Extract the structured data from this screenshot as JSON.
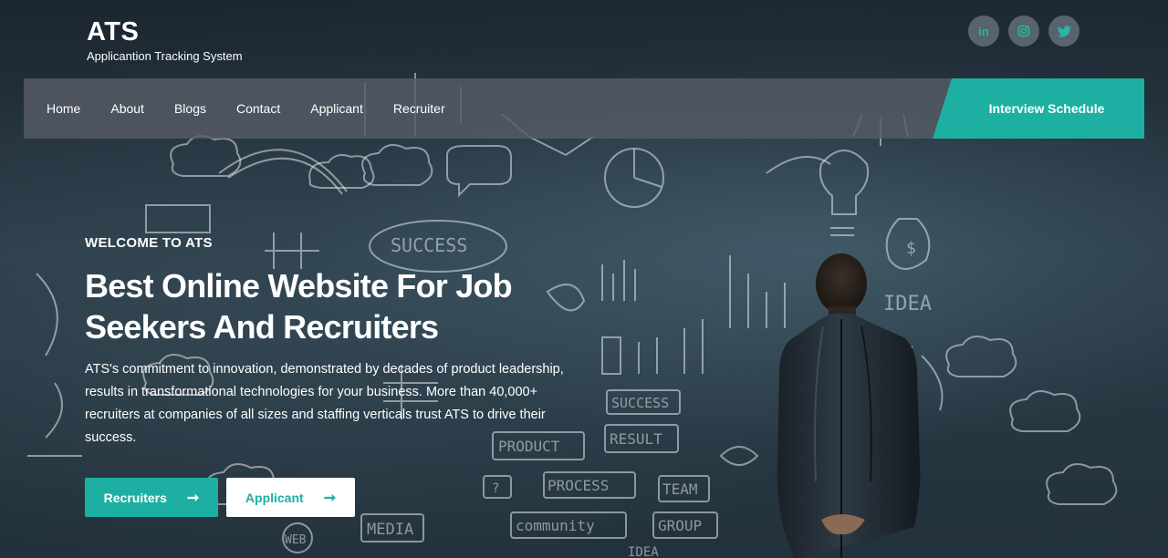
{
  "brand": {
    "title": "ATS",
    "subtitle": "Applicantion Tracking System"
  },
  "social": [
    {
      "label": "in",
      "icon": "linkedin-icon"
    },
    {
      "label": "◎",
      "icon": "instagram-icon"
    },
    {
      "label": "🐦",
      "icon": "twitter-icon"
    }
  ],
  "nav": {
    "items": [
      "Home",
      "About",
      "Blogs",
      "Contact",
      "Applicant",
      "Recruiter"
    ],
    "cta": "Interview Schedule"
  },
  "hero": {
    "eyebrow": "WELCOME TO ATS",
    "headline": "Best Online Website For Job Seekers And Recruiters",
    "description": "ATS's commitment to innovation, demonstrated by decades of product leadership, results in transformational technologies for your business. More than 40,000+ recruiters at companies of all sizes and staffing verticals trust ATS to drive their success.",
    "buttons": {
      "recruiters": "Recruiters",
      "applicant": "Applicant",
      "arrow": "➞"
    }
  },
  "sketch_words": [
    "SUCCESS",
    "SUCCESS",
    "RESULT",
    "PRODUCT",
    "PROCESS",
    "TEAM",
    "GROUP",
    "community",
    "MEDIA",
    "IDEA",
    "IDEA",
    "WEB",
    "?",
    "$"
  ],
  "colors": {
    "accent": "#1db0a2",
    "nav_bg": "#555c66",
    "bg_dark": "#1f2a33"
  }
}
